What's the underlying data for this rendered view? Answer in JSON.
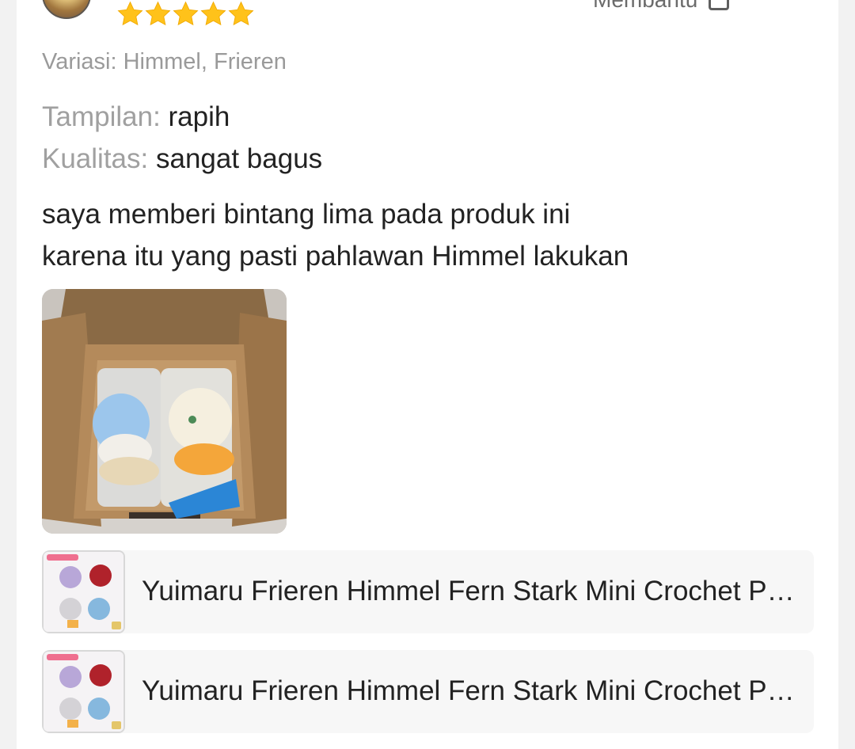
{
  "review": {
    "rating": 5,
    "helpful_label": "Membantu",
    "variation": "Variasi: Himmel, Frieren",
    "attributes": [
      {
        "key": "Tampilan:",
        "value": "rapih"
      },
      {
        "key": "Kualitas:",
        "value": "sangat bagus"
      }
    ],
    "text_line1": "saya memberi bintang lima pada produk ini",
    "text_line2": "karena itu yang pasti pahlawan Himmel lakukan"
  },
  "products": [
    {
      "title": "Yuimaru Frieren Himmel Fern Stark Mini Crochet Plush Keychain"
    },
    {
      "title": "Yuimaru Frieren Himmel Fern Stark Mini Crochet Plush Keychain"
    }
  ],
  "colors": {
    "star": "#ffc21a",
    "muted_text": "#9a9a9a",
    "body_text": "#222222",
    "card_bg": "#ffffff",
    "page_bg": "#f2f2f2"
  }
}
